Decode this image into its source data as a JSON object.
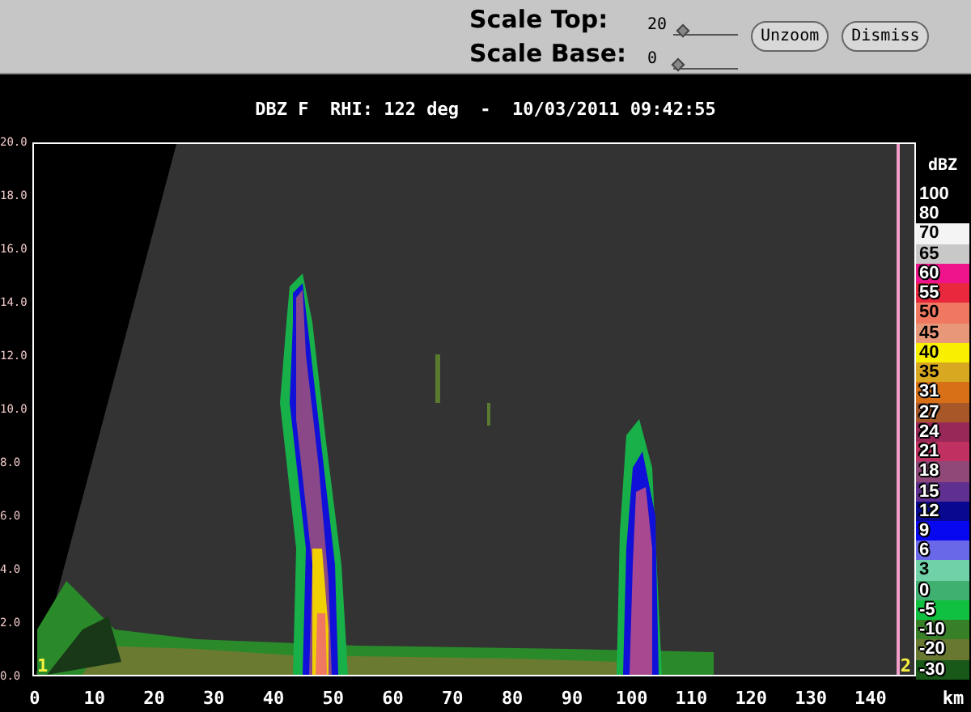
{
  "controls": {
    "sliders": [
      {
        "label": "Scale Top:",
        "value": "20",
        "level": 0.1
      },
      {
        "label": "Scale Base:",
        "value": "0",
        "level": 0
      }
    ],
    "buttons": [
      "Unzoom",
      "Dismiss"
    ]
  },
  "plot": {
    "title": "DBZ F  RHI: 122 deg  -  10/03/2011 09:42:55",
    "y_labels": [
      "20.0",
      "18.0",
      "16.0",
      "14.0",
      "12.0",
      "10.0",
      "8.0",
      "6.0",
      "4.0",
      "2.0",
      "0.0"
    ],
    "x_labels": [
      "0",
      "10",
      "20",
      "30",
      "40",
      "50",
      "60",
      "70",
      "80",
      "90",
      "100",
      "110",
      "120",
      "130",
      "140"
    ],
    "x_unit": "km",
    "markers": [
      "1",
      "2"
    ]
  },
  "legend": {
    "title": "dBZ",
    "items": [
      {
        "label": "100",
        "color": "#000000"
      },
      {
        "label": "80",
        "color": "#000000"
      },
      {
        "label": "70",
        "color": "#f4f4f4"
      },
      {
        "label": "65",
        "color": "#c8c8c8"
      },
      {
        "label": "60",
        "color": "#f0148c"
      },
      {
        "label": "55",
        "color": "#e8283c"
      },
      {
        "label": "50",
        "color": "#f07860"
      },
      {
        "label": "45",
        "color": "#e89878"
      },
      {
        "label": "40",
        "color": "#f8f000"
      },
      {
        "label": "35",
        "color": "#d8a820"
      },
      {
        "label": "31",
        "color": "#d87018"
      },
      {
        "label": "27",
        "color": "#a85828"
      },
      {
        "label": "24",
        "color": "#982858"
      },
      {
        "label": "21",
        "color": "#c03060"
      },
      {
        "label": "18",
        "color": "#904878"
      },
      {
        "label": "15",
        "color": "#603090"
      },
      {
        "label": "12",
        "color": "#080890"
      },
      {
        "label": "9",
        "color": "#0808f0"
      },
      {
        "label": "6",
        "color": "#6868e8"
      },
      {
        "label": "3",
        "color": "#70d0a8"
      },
      {
        "label": "0",
        "color": "#40b070"
      },
      {
        "label": "-5",
        "color": "#10c040"
      },
      {
        "label": "-10",
        "color": "#388028"
      },
      {
        "label": "-20",
        "color": "#687830"
      },
      {
        "label": "-30",
        "color": "#185818"
      }
    ]
  }
}
